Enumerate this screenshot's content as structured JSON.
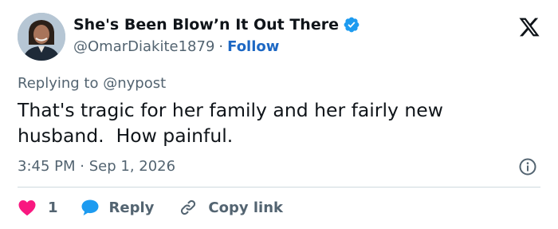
{
  "author": {
    "display_name": "She's Been Blow’n It Out There",
    "handle": "@OmarDiakite1879",
    "separator": "·",
    "follow_label": "Follow",
    "verified": true,
    "avatar_icon": "profile-photo"
  },
  "platform": {
    "logo_icon": "x-logo-icon"
  },
  "reply_context": {
    "prefix": "Replying to",
    "mention": "@nypost"
  },
  "tweet": {
    "text": "That's tragic for her family and her fairly new husband.  How painful."
  },
  "meta": {
    "time": "3:45 PM",
    "separator": "·",
    "date": "Sep 1, 2026"
  },
  "actions": {
    "like_count": "1",
    "reply_label": "Reply",
    "copy_link_label": "Copy link"
  },
  "colors": {
    "link": "#1d68c4",
    "verified": "#1d9bf0",
    "like": "#f91880",
    "reply_bubble": "#1d9bf0",
    "muted": "#536471",
    "divider": "#cfd9de"
  }
}
